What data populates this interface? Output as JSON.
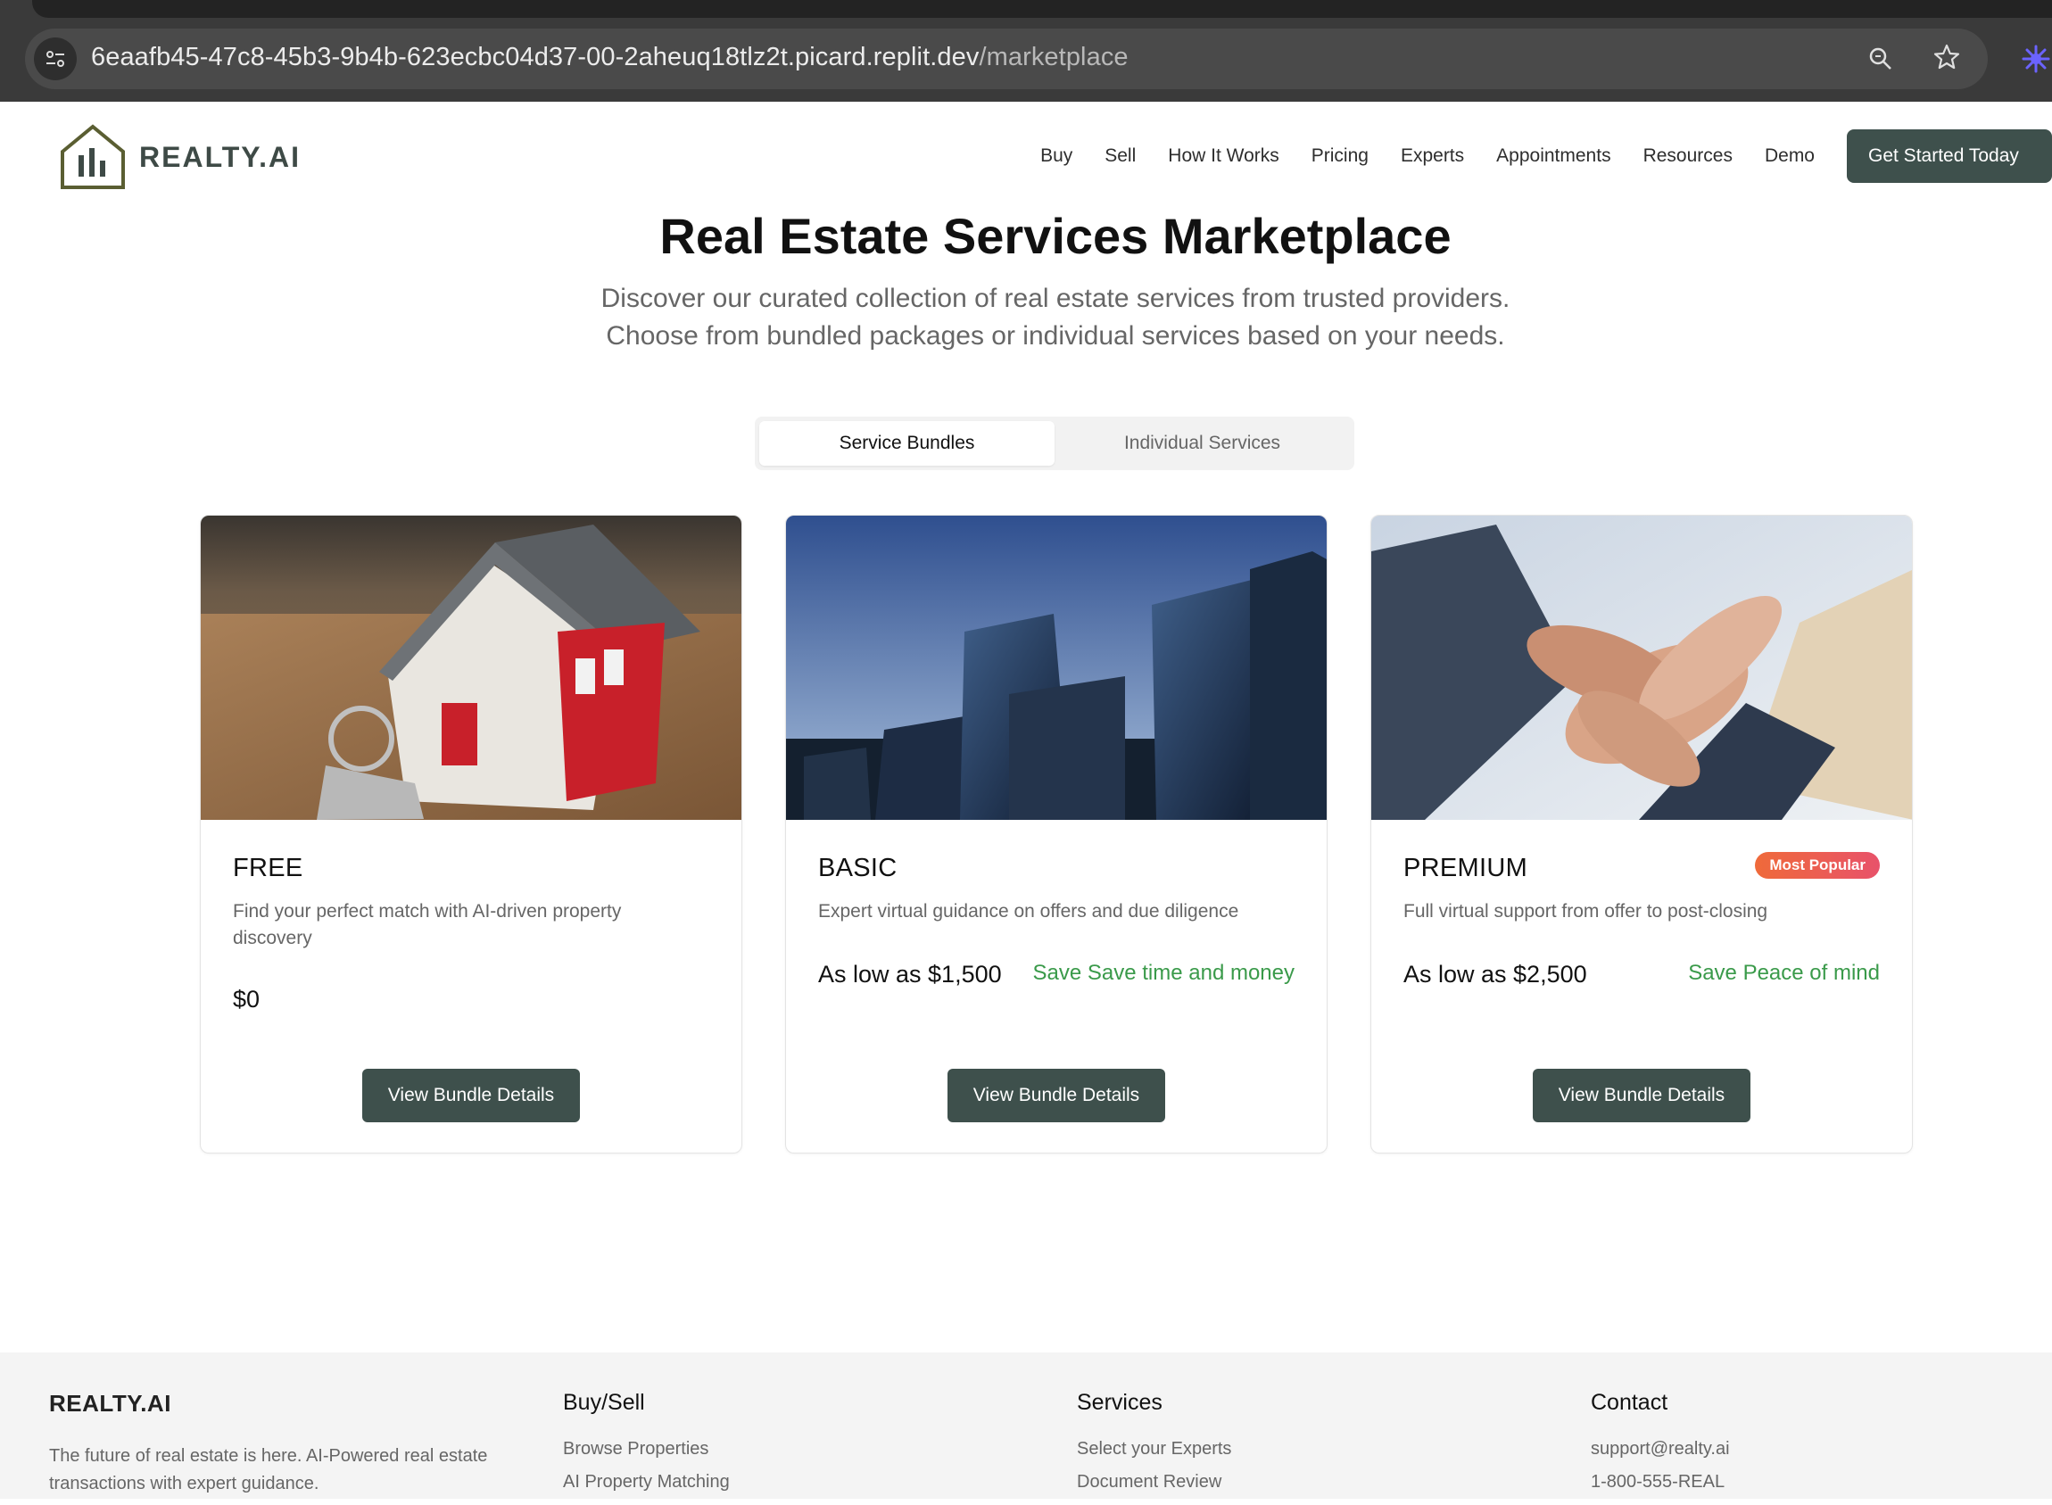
{
  "browser": {
    "url_host": "6eaafb45-47c8-45b3-9b4b-623ecbc04d37-00-2aheuq18tlz2t.picard.replit.dev",
    "url_path": "/marketplace"
  },
  "header": {
    "brand": "REALTY.AI",
    "nav": [
      "Buy",
      "Sell",
      "How It Works",
      "Pricing",
      "Experts",
      "Appointments",
      "Resources",
      "Demo"
    ],
    "cta": "Get Started Today"
  },
  "hero": {
    "title": "Real Estate Services Marketplace",
    "subtitle_line1": "Discover our curated collection of real estate services from trusted providers.",
    "subtitle_line2": "Choose from bundled packages or individual services based on your needs."
  },
  "tabs": [
    {
      "label": "Service Bundles",
      "active": true
    },
    {
      "label": "Individual Services",
      "active": false
    }
  ],
  "bundles": [
    {
      "name": "FREE",
      "description": "Find your perfect match with AI-driven property discovery",
      "price": "$0",
      "save": "",
      "badge": "",
      "button": "View Bundle Details",
      "image": "house-model-with-keys"
    },
    {
      "name": "BASIC",
      "description": "Expert virtual guidance on offers and due diligence",
      "price": "As low as $1,500",
      "save": "Save Save time and money",
      "badge": "",
      "button": "View Bundle Details",
      "image": "city-skyscrapers"
    },
    {
      "name": "PREMIUM",
      "description": "Full virtual support from offer to post-closing",
      "price": "As low as $2,500",
      "save": "Save Peace of mind",
      "badge": "Most Popular",
      "button": "View Bundle Details",
      "image": "joined-hands-teamwork"
    }
  ],
  "footer": {
    "brand": "REALTY.AI",
    "tagline": "The future of real estate is here. AI-Powered real estate transactions with expert guidance.",
    "columns": [
      {
        "heading": "Buy/Sell",
        "links": [
          "Browse Properties",
          "AI Property Matching"
        ]
      },
      {
        "heading": "Services",
        "links": [
          "Select your Experts",
          "Document Review"
        ]
      },
      {
        "heading": "Contact",
        "links": [
          "support@realty.ai",
          "1-800-555-REAL"
        ]
      }
    ]
  },
  "colors": {
    "primary": "#3e504c",
    "save_green": "#3a9a4a",
    "badge_orange": "#ef6a3a",
    "logo_olive": "#5a5e32"
  }
}
